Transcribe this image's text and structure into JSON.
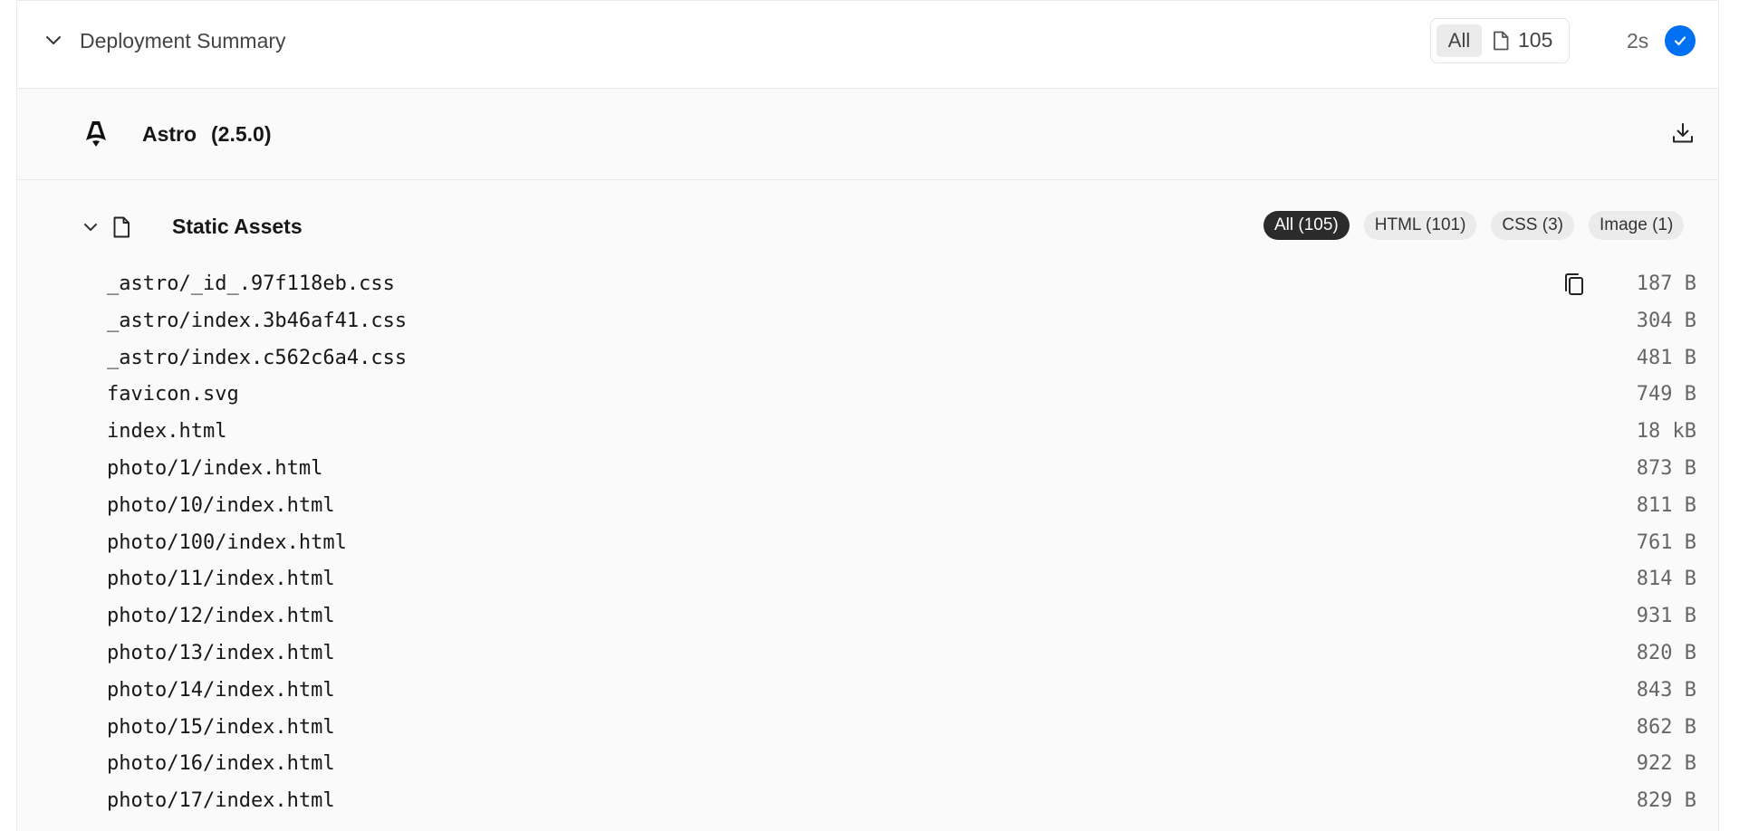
{
  "summary": {
    "title": "Deployment Summary",
    "filter_all": "All",
    "file_count": "105",
    "duration": "2s",
    "status_color": "#0070f3"
  },
  "framework": {
    "name": "Astro",
    "version": "(2.5.0)",
    "icons": [
      "astro-logo",
      "download-icon"
    ]
  },
  "assets": {
    "title": "Static Assets",
    "filters": [
      {
        "label": "All (105)",
        "active": true
      },
      {
        "label": "HTML (101)",
        "active": false
      },
      {
        "label": "CSS (3)",
        "active": false
      },
      {
        "label": "Image (1)",
        "active": false
      }
    ],
    "files": [
      {
        "path": "_astro/_id_.97f118eb.css",
        "size": "187 B"
      },
      {
        "path": "_astro/index.3b46af41.css",
        "size": "304 B"
      },
      {
        "path": "_astro/index.c562c6a4.css",
        "size": "481 B"
      },
      {
        "path": "favicon.svg",
        "size": "749 B"
      },
      {
        "path": "index.html",
        "size": "18 kB"
      },
      {
        "path": "photo/1/index.html",
        "size": "873 B"
      },
      {
        "path": "photo/10/index.html",
        "size": "811 B"
      },
      {
        "path": "photo/100/index.html",
        "size": "761 B"
      },
      {
        "path": "photo/11/index.html",
        "size": "814 B"
      },
      {
        "path": "photo/12/index.html",
        "size": "931 B"
      },
      {
        "path": "photo/13/index.html",
        "size": "820 B"
      },
      {
        "path": "photo/14/index.html",
        "size": "843 B"
      },
      {
        "path": "photo/15/index.html",
        "size": "862 B"
      },
      {
        "path": "photo/16/index.html",
        "size": "922 B"
      },
      {
        "path": "photo/17/index.html",
        "size": "829 B"
      }
    ]
  }
}
